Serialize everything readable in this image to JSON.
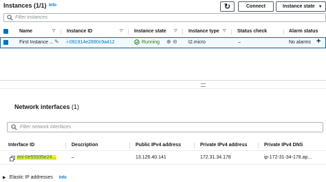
{
  "instances": {
    "title": "Instances",
    "count": "(1/1)",
    "info": "Info",
    "refresh_label": "↻",
    "connect_label": "Connect",
    "state_button_label": "Instance state",
    "filter_placeholder": "Filter instances",
    "columns": [
      "Name",
      "Instance ID",
      "Instance state",
      "Instance type",
      "Status check",
      "Alarm status"
    ],
    "row": {
      "name": "First Instance ...",
      "id": "i-091914e2890c9a412",
      "state": "Running",
      "type": "t2.micro",
      "status": "–",
      "alarm": "No alarms",
      "add": "+"
    }
  },
  "network": {
    "title": "Network interfaces",
    "count": "(1)",
    "filter_placeholder": "Filter network interfaces",
    "columns": [
      "Interface ID",
      "Description",
      "Public IPv4 address",
      "Private IPv4 address",
      "Private IPv4 DNS"
    ],
    "row": {
      "id": "eni-0e55935e24...",
      "desc": "–",
      "public_ip": "13.126.40.141",
      "private_ip": "172.31.34.178",
      "dns": "ip-172-31-34-178.ap..."
    }
  },
  "elastic": {
    "label": "Elastic IP addresses",
    "info": "Info"
  },
  "colors": {
    "accent": "#0073bb",
    "running": "#1d8102",
    "highlight": "#f2f21a",
    "selected_row": "#f1faff"
  }
}
